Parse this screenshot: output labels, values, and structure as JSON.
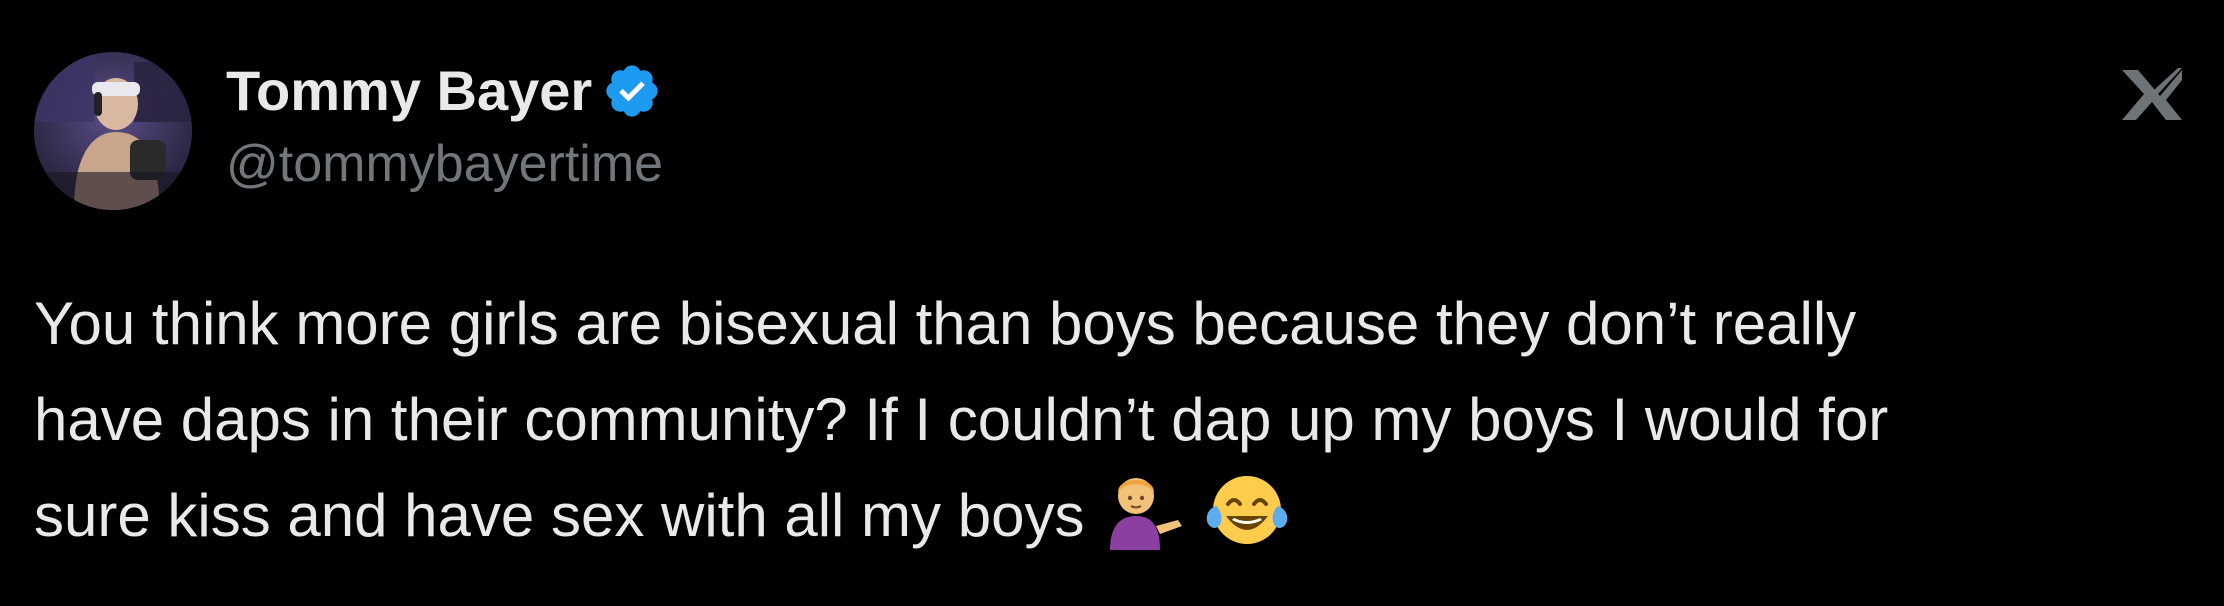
{
  "author": {
    "display_name": "Tommy Bayer",
    "handle": "@tommybayertime",
    "verified": true,
    "verified_color": "#1d9bf0"
  },
  "tweet": {
    "lines": [
      "You think more girls are bisexual than boys because they don’t really",
      "have daps in their community? If I couldn’t dap up my boys I would for",
      "sure kiss and have sex with all my boys"
    ],
    "emojis": [
      "person-tipping-hand-emoji",
      "face-with-tears-of-joy-emoji"
    ]
  },
  "icons": {
    "brand": "x-logo-icon",
    "badge": "verified-badge-icon"
  },
  "colors": {
    "background": "#000000",
    "text": "#e7e9ea",
    "secondary_text": "#71767b"
  }
}
